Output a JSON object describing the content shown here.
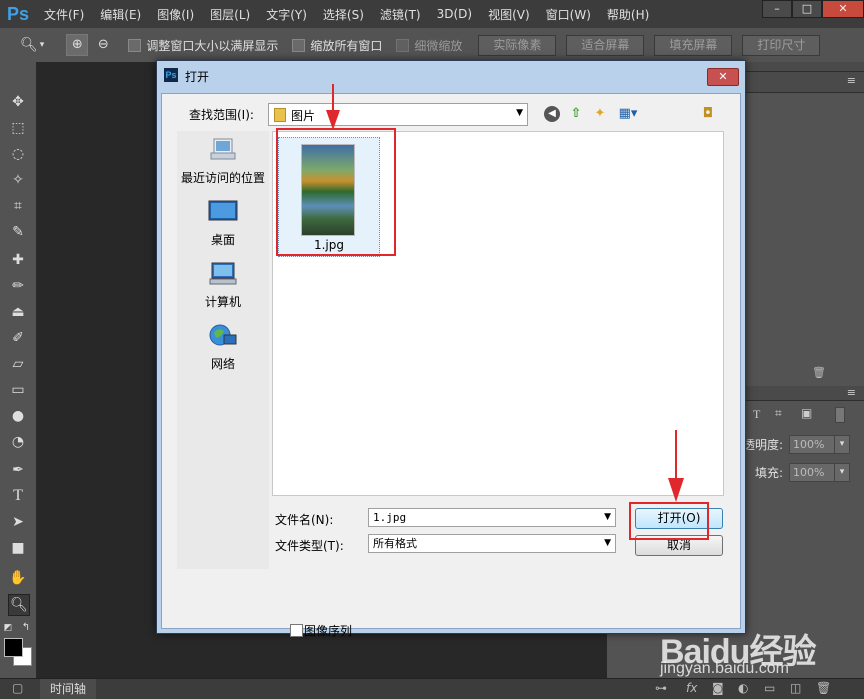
{
  "app": {
    "logo": "Ps"
  },
  "menubar": {
    "items": [
      "文件(F)",
      "编辑(E)",
      "图像(I)",
      "图层(L)",
      "文字(Y)",
      "选择(S)",
      "滤镜(T)",
      "3D(D)",
      "视图(V)",
      "窗口(W)",
      "帮助(H)"
    ],
    "window_controls": [
      "–",
      "□",
      "✕"
    ]
  },
  "options_bar": {
    "resize_windows_label": "调整窗口大小以满屏显示",
    "zoom_all_windows_label": "缩放所有窗口",
    "scrubby_zoom_label": "细微缩放",
    "buttons": [
      "实际像素",
      "适合屏幕",
      "填充屏幕",
      "打印尺寸"
    ]
  },
  "dialog": {
    "title": "打开",
    "close_label": "✕",
    "look_in_label": "查找范围(I):",
    "look_in_value": "图片",
    "places": [
      "最近访问的位置",
      "桌面",
      "计算机",
      "网络"
    ],
    "file": {
      "name": "1.jpg"
    },
    "filename_label": "文件名(N):",
    "filename_value": "1.jpg",
    "filetype_label": "文件类型(T):",
    "filetype_value": "所有格式",
    "open_button": "打开(O)",
    "cancel_button": "取消",
    "image_sequence_label": "图像序列"
  },
  "layers_panel": {
    "opacity_label": "透明度:",
    "opacity_value": "100%",
    "fill_label": "填充:",
    "fill_value": "100%"
  },
  "status": {
    "timeline_tab": "时间轴"
  },
  "watermark": {
    "logo": "Baidu经验",
    "site": "jingyan.baidu.com"
  },
  "colors": {
    "annotation_red": "#e0282c",
    "ps_blue": "#3ea0e6"
  }
}
